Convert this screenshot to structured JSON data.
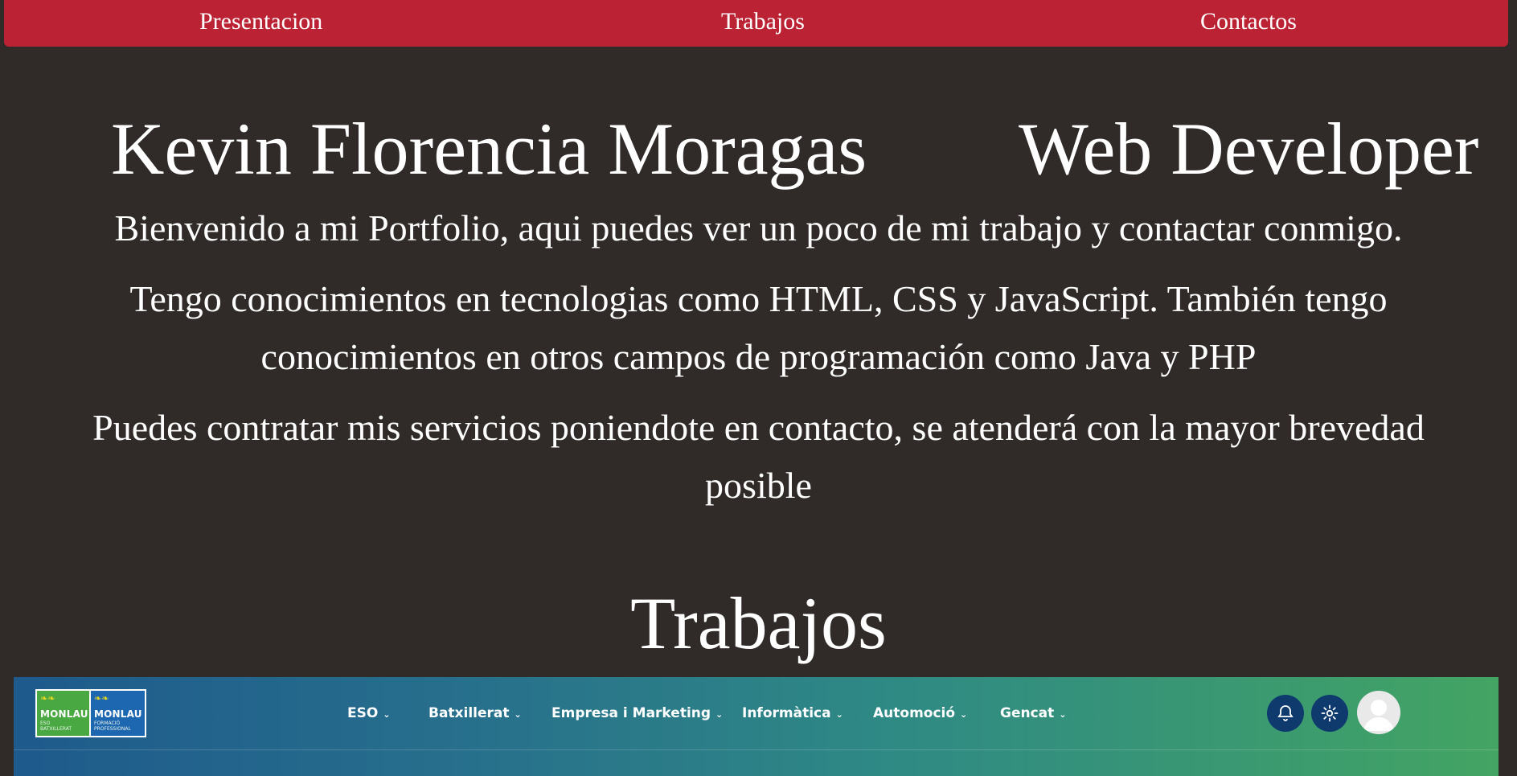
{
  "nav": {
    "items": [
      {
        "label": "Presentacion"
      },
      {
        "label": "Trabajos"
      },
      {
        "label": "Contactos"
      }
    ]
  },
  "hero": {
    "name": "Kevin Florencia Moragas",
    "role": "Web Developer"
  },
  "intro": {
    "p1": "Bienvenido a mi Portfolio, aqui puedes ver un poco de mi trabajo y contactar conmigo.",
    "p2": "Tengo conocimientos en tecnologias como HTML, CSS y JavaScript. También tengo conocimientos en otros campos de programación como Java y PHP",
    "p3": "Puedes contratar mis servicios poniendote en contacto, se atenderá con la mayor brevedad posible"
  },
  "works": {
    "title": "Trabajos",
    "screenshot": {
      "logo": {
        "left_brand": "MONLAU",
        "left_sub": "ESO\nBATXILLERAT",
        "right_brand": "MONLAU",
        "right_sub": "FORMACIÓ\nPROFESSIONAL"
      },
      "menu": [
        {
          "label": "ESO"
        },
        {
          "label": "Batxillerat"
        },
        {
          "label": "Empresa i Marketing"
        },
        {
          "label": "Informàtica"
        },
        {
          "label": "Automoció"
        },
        {
          "label": "Gencat"
        }
      ],
      "icons": {
        "notifications": "bell-icon",
        "settings": "gear-icon",
        "avatar": "user-avatar-icon"
      }
    }
  },
  "colors": {
    "background": "#302a28",
    "nav": "#bb2233",
    "text": "#ffffff"
  }
}
